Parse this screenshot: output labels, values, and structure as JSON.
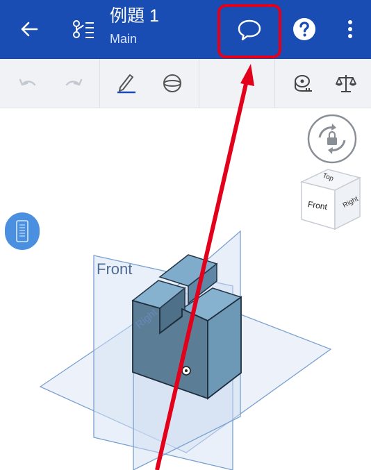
{
  "appbar": {
    "title": "例題 1",
    "subtitle": "Main",
    "icons": [
      "back-arrow-icon",
      "version-graph-icon",
      "comment-icon",
      "help-icon",
      "more-vert-icon"
    ]
  },
  "toolbar": {
    "icons": [
      "undo-icon",
      "redo-icon",
      "sketch-pencil-icon",
      "plane-sphere-icon",
      "measure-tape-icon",
      "mass-properties-icon"
    ]
  },
  "viewport": {
    "plane_label_front": "Front",
    "plane_label_right": "Right",
    "view_cube": {
      "top": "Top",
      "front": "Front",
      "right": "Right"
    }
  },
  "colors": {
    "appbar": "#1a4db3",
    "annotation": "#e3001b",
    "part": "#5e7f98",
    "plane_edge": "#6f95c9",
    "panel_button": "#4a8fe0"
  }
}
